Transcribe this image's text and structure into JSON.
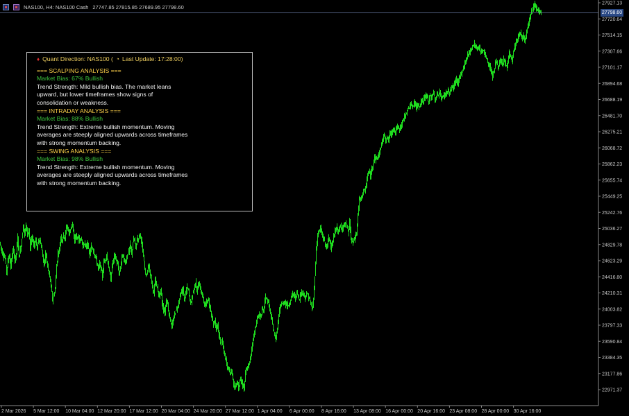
{
  "header": {
    "symbol_info": "NAS100, H4: NAS100 Cash",
    "ohlc": "27747.85 27815.85 27689.95 27798.60"
  },
  "panel": {
    "title": "Quant Direction: NAS100 (",
    "last_update": "Last Update: 17:28:00)",
    "sections": [
      {
        "heading": "=== SCALPING ANALYSIS ===",
        "bias": "Market Bias: 67% Bullish",
        "strength": [
          "Trend Strength: Mild bullish bias. The market leans",
          "upward, but lower timeframes show signs of",
          "consolidation or weakness."
        ]
      },
      {
        "heading": "=== INTRADAY ANALYSIS ===",
        "bias": "Market Bias: 88% Bullish",
        "strength": [
          "Trend Strength: Extreme bullish momentum. Moving",
          "averages are steeply aligned upwards across timeframes",
          "with strong momentum backing."
        ]
      },
      {
        "heading": "=== SWING ANALYSIS ===",
        "bias": "Market Bias: 98% Bullish",
        "strength": [
          "Trend Strength: Extreme bullish momentum. Moving",
          "averages are steeply aligned upwards across timeframes",
          "with strong momentum backing."
        ]
      }
    ]
  },
  "price_tag": "27798.60",
  "chart_data": {
    "type": "candlestick",
    "yticks": [
      "27927.13",
      "27720.64",
      "27514.15",
      "27307.66",
      "27101.17",
      "26894.68",
      "26688.19",
      "26481.70",
      "26275.21",
      "26068.72",
      "25862.23",
      "25655.74",
      "25449.25",
      "25242.76",
      "25036.27",
      "24829.78",
      "24623.29",
      "24416.80",
      "24210.31",
      "24003.82",
      "23797.33",
      "23590.84",
      "23384.35",
      "23177.86",
      "22971.37"
    ],
    "xticks": [
      "2 Mar 2026",
      "5 Mar 12:00",
      "10 Mar 04:00",
      "12 Mar 20:00",
      "17 Mar 12:00",
      "20 Mar 04:00",
      "24 Mar 20:00",
      "27 Mar 12:00",
      "1 Apr 04:00",
      "6 Apr 00:00",
      "8 Apr 16:00",
      "13 Apr 08:00",
      "16 Apr 00:00",
      "20 Apr 16:00",
      "23 Apr 08:00",
      "28 Apr 00:00",
      "30 Apr 16:00"
    ],
    "current_price": 27798.6,
    "up_color": "#1fdc1f",
    "down_color": "#1fdc1f",
    "path": [
      [
        0,
        24860
      ],
      [
        4,
        24720
      ],
      [
        8,
        24650
      ],
      [
        10,
        24480
      ],
      [
        12,
        24620
      ],
      [
        14,
        24700
      ],
      [
        16,
        24540
      ],
      [
        18,
        24700
      ],
      [
        20,
        24760
      ],
      [
        22,
        24620
      ],
      [
        24,
        24720
      ],
      [
        26,
        24920
      ],
      [
        28,
        24680
      ],
      [
        30,
        24760
      ],
      [
        32,
        24900
      ],
      [
        34,
        25090
      ],
      [
        36,
        24950
      ],
      [
        38,
        25090
      ],
      [
        40,
        24970
      ],
      [
        42,
        25000
      ],
      [
        44,
        24780
      ],
      [
        46,
        24920
      ],
      [
        48,
        24890
      ],
      [
        50,
        24800
      ],
      [
        52,
        24920
      ],
      [
        54,
        24760
      ],
      [
        56,
        24900
      ],
      [
        58,
        24880
      ],
      [
        60,
        24800
      ],
      [
        62,
        24690
      ],
      [
        64,
        24560
      ],
      [
        66,
        24720
      ],
      [
        68,
        24620
      ],
      [
        70,
        24500
      ],
      [
        72,
        24420
      ],
      [
        74,
        24300
      ],
      [
        76,
        24120
      ],
      [
        78,
        24180
      ],
      [
        80,
        24260
      ],
      [
        82,
        24560
      ],
      [
        84,
        24720
      ],
      [
        86,
        24760
      ],
      [
        88,
        24930
      ],
      [
        90,
        24880
      ],
      [
        92,
        24960
      ],
      [
        94,
        24900
      ],
      [
        96,
        25060
      ],
      [
        98,
        25050
      ],
      [
        100,
        24960
      ],
      [
        102,
        25040
      ],
      [
        104,
        25090
      ],
      [
        106,
        24990
      ],
      [
        108,
        24880
      ],
      [
        110,
        24960
      ],
      [
        112,
        24880
      ],
      [
        114,
        24930
      ],
      [
        116,
        24880
      ],
      [
        118,
        24900
      ],
      [
        120,
        24800
      ],
      [
        122,
        24860
      ],
      [
        124,
        24780
      ],
      [
        126,
        24860
      ],
      [
        128,
        24760
      ],
      [
        130,
        24700
      ],
      [
        132,
        24800
      ],
      [
        134,
        24780
      ],
      [
        136,
        24720
      ],
      [
        138,
        24680
      ],
      [
        140,
        24600
      ],
      [
        142,
        24520
      ],
      [
        144,
        24580
      ],
      [
        146,
        24520
      ],
      [
        148,
        24420
      ],
      [
        150,
        24600
      ],
      [
        152,
        24640
      ],
      [
        154,
        24700
      ],
      [
        156,
        24600
      ],
      [
        158,
        24480
      ],
      [
        160,
        24380
      ],
      [
        162,
        24560
      ],
      [
        164,
        24640
      ],
      [
        166,
        24700
      ],
      [
        168,
        24620
      ],
      [
        170,
        24570
      ],
      [
        172,
        24460
      ],
      [
        174,
        24520
      ],
      [
        176,
        24690
      ],
      [
        178,
        24680
      ],
      [
        180,
        24600
      ],
      [
        182,
        24620
      ],
      [
        184,
        24700
      ],
      [
        186,
        24740
      ],
      [
        188,
        24820
      ],
      [
        190,
        24700
      ],
      [
        192,
        24860
      ],
      [
        194,
        24900
      ],
      [
        196,
        24780
      ],
      [
        198,
        24900
      ],
      [
        200,
        24920
      ],
      [
        202,
        24960
      ],
      [
        204,
        24900
      ],
      [
        206,
        24740
      ],
      [
        208,
        24600
      ],
      [
        210,
        24460
      ],
      [
        212,
        24440
      ],
      [
        214,
        24560
      ],
      [
        216,
        24500
      ],
      [
        218,
        24420
      ],
      [
        220,
        24260
      ],
      [
        222,
        24200
      ],
      [
        224,
        24400
      ],
      [
        226,
        24300
      ],
      [
        228,
        24240
      ],
      [
        230,
        24160
      ],
      [
        232,
        24260
      ],
      [
        234,
        24080
      ],
      [
        236,
        24000
      ],
      [
        238,
        23960
      ],
      [
        240,
        24120
      ],
      [
        242,
        24060
      ],
      [
        244,
        23940
      ],
      [
        246,
        23860
      ],
      [
        248,
        23760
      ],
      [
        250,
        23860
      ],
      [
        252,
        23940
      ],
      [
        254,
        24000
      ],
      [
        256,
        24020
      ],
      [
        258,
        24100
      ],
      [
        260,
        24180
      ],
      [
        262,
        24220
      ],
      [
        264,
        24260
      ],
      [
        266,
        24120
      ],
      [
        268,
        24200
      ],
      [
        270,
        24280
      ],
      [
        272,
        24240
      ],
      [
        274,
        24120
      ],
      [
        276,
        24080
      ],
      [
        278,
        24200
      ],
      [
        280,
        24260
      ],
      [
        282,
        24360
      ],
      [
        284,
        24240
      ],
      [
        286,
        24300
      ],
      [
        288,
        24320
      ],
      [
        290,
        24220
      ],
      [
        292,
        24180
      ],
      [
        294,
        24100
      ],
      [
        296,
        24040
      ],
      [
        298,
        24100
      ],
      [
        300,
        24140
      ],
      [
        302,
        24040
      ],
      [
        304,
        23980
      ],
      [
        306,
        23900
      ],
      [
        308,
        23800
      ],
      [
        310,
        23860
      ],
      [
        312,
        23760
      ],
      [
        314,
        23820
      ],
      [
        316,
        23660
      ],
      [
        318,
        23560
      ],
      [
        320,
        23620
      ],
      [
        322,
        23500
      ],
      [
        324,
        23420
      ],
      [
        326,
        23340
      ],
      [
        328,
        23220
      ],
      [
        330,
        23260
      ],
      [
        332,
        23180
      ],
      [
        334,
        23240
      ],
      [
        336,
        23100
      ],
      [
        338,
        23000
      ],
      [
        340,
        23020
      ],
      [
        342,
        23080
      ],
      [
        344,
        22980
      ],
      [
        346,
        23120
      ],
      [
        348,
        23060
      ],
      [
        350,
        23040
      ],
      [
        352,
        22980
      ],
      [
        354,
        23180
      ],
      [
        356,
        23240
      ],
      [
        358,
        23260
      ],
      [
        360,
        23320
      ],
      [
        362,
        23440
      ],
      [
        364,
        23560
      ],
      [
        366,
        23660
      ],
      [
        368,
        23760
      ],
      [
        370,
        23840
      ],
      [
        372,
        23900
      ],
      [
        374,
        23940
      ],
      [
        376,
        23900
      ],
      [
        378,
        24000
      ],
      [
        380,
        23980
      ],
      [
        382,
        24120
      ],
      [
        384,
        24160
      ],
      [
        386,
        24100
      ],
      [
        388,
        24060
      ],
      [
        390,
        23940
      ],
      [
        392,
        23860
      ],
      [
        394,
        23740
      ],
      [
        396,
        23680
      ],
      [
        398,
        23620
      ],
      [
        400,
        23760
      ],
      [
        402,
        23920
      ],
      [
        404,
        24020
      ],
      [
        406,
        24080
      ],
      [
        408,
        24060
      ],
      [
        410,
        24100
      ],
      [
        412,
        24080
      ],
      [
        414,
        24040
      ],
      [
        416,
        24060
      ],
      [
        418,
        24080
      ],
      [
        420,
        24160
      ],
      [
        422,
        24200
      ],
      [
        424,
        24180
      ],
      [
        426,
        24140
      ],
      [
        428,
        24220
      ],
      [
        430,
        24160
      ],
      [
        432,
        24120
      ],
      [
        434,
        24240
      ],
      [
        436,
        24180
      ],
      [
        438,
        24220
      ],
      [
        440,
        24140
      ],
      [
        442,
        24200
      ],
      [
        444,
        24180
      ],
      [
        446,
        24140
      ],
      [
        448,
        24060
      ],
      [
        450,
        24000
      ],
      [
        452,
        24120
      ],
      [
        454,
        24440
      ],
      [
        456,
        24760
      ],
      [
        458,
        24960
      ],
      [
        460,
        25000
      ],
      [
        462,
        25040
      ],
      [
        464,
        24960
      ],
      [
        466,
        24920
      ],
      [
        468,
        24860
      ],
      [
        470,
        24800
      ],
      [
        472,
        24820
      ],
      [
        474,
        24920
      ],
      [
        476,
        24860
      ],
      [
        478,
        24800
      ],
      [
        480,
        24860
      ],
      [
        482,
        24960
      ],
      [
        484,
        25020
      ],
      [
        486,
        25040
      ],
      [
        488,
        25000
      ],
      [
        490,
        25040
      ],
      [
        492,
        25060
      ],
      [
        494,
        25040
      ],
      [
        496,
        25080
      ],
      [
        498,
        25100
      ],
      [
        500,
        25060
      ],
      [
        502,
        24980
      ],
      [
        504,
        25120
      ],
      [
        506,
        24900
      ],
      [
        508,
        24860
      ],
      [
        510,
        24880
      ],
      [
        512,
        24920
      ],
      [
        514,
        24980
      ],
      [
        516,
        25200
      ],
      [
        518,
        25420
      ],
      [
        520,
        25400
      ],
      [
        522,
        25460
      ],
      [
        524,
        25540
      ],
      [
        526,
        25500
      ],
      [
        528,
        25600
      ],
      [
        530,
        25720
      ],
      [
        532,
        25760
      ],
      [
        534,
        25700
      ],
      [
        536,
        25800
      ],
      [
        538,
        25880
      ],
      [
        540,
        25960
      ],
      [
        542,
        25920
      ],
      [
        544,
        25940
      ],
      [
        546,
        25980
      ],
      [
        548,
        26040
      ],
      [
        550,
        26120
      ],
      [
        552,
        26180
      ],
      [
        554,
        26240
      ],
      [
        556,
        26180
      ],
      [
        558,
        26200
      ],
      [
        560,
        26160
      ],
      [
        562,
        26260
      ],
      [
        564,
        26240
      ],
      [
        566,
        26300
      ],
      [
        568,
        26320
      ],
      [
        570,
        26260
      ],
      [
        572,
        26340
      ],
      [
        574,
        26320
      ],
      [
        576,
        26300
      ],
      [
        578,
        26360
      ],
      [
        580,
        26400
      ],
      [
        582,
        26440
      ],
      [
        584,
        26480
      ],
      [
        586,
        26520
      ],
      [
        588,
        26560
      ],
      [
        590,
        26600
      ],
      [
        592,
        26620
      ],
      [
        594,
        26580
      ],
      [
        596,
        26620
      ],
      [
        598,
        26660
      ],
      [
        600,
        26560
      ],
      [
        602,
        26640
      ],
      [
        604,
        26600
      ],
      [
        606,
        26620
      ],
      [
        608,
        26680
      ],
      [
        610,
        26660
      ],
      [
        612,
        26720
      ],
      [
        614,
        26740
      ],
      [
        616,
        26700
      ],
      [
        618,
        26660
      ],
      [
        620,
        26740
      ],
      [
        622,
        26700
      ],
      [
        624,
        26780
      ],
      [
        626,
        26720
      ],
      [
        628,
        26680
      ],
      [
        630,
        26760
      ],
      [
        632,
        26740
      ],
      [
        634,
        26780
      ],
      [
        636,
        26700
      ],
      [
        638,
        26720
      ],
      [
        640,
        26740
      ],
      [
        642,
        26760
      ],
      [
        644,
        26780
      ],
      [
        646,
        26800
      ],
      [
        648,
        26760
      ],
      [
        650,
        26820
      ],
      [
        652,
        26860
      ],
      [
        654,
        26840
      ],
      [
        656,
        26920
      ],
      [
        658,
        26940
      ],
      [
        660,
        26880
      ],
      [
        662,
        26960
      ],
      [
        664,
        27020
      ],
      [
        666,
        27040
      ],
      [
        668,
        27080
      ],
      [
        670,
        27160
      ],
      [
        672,
        27200
      ],
      [
        674,
        27260
      ],
      [
        676,
        27280
      ],
      [
        678,
        27320
      ],
      [
        680,
        27360
      ],
      [
        682,
        27380
      ],
      [
        684,
        27400
      ],
      [
        686,
        27360
      ],
      [
        688,
        27340
      ],
      [
        690,
        27360
      ],
      [
        692,
        27320
      ],
      [
        694,
        27300
      ],
      [
        696,
        27320
      ],
      [
        698,
        27280
      ],
      [
        700,
        27240
      ],
      [
        702,
        27200
      ],
      [
        704,
        27140
      ],
      [
        706,
        27100
      ],
      [
        708,
        27060
      ],
      [
        710,
        26980
      ],
      [
        712,
        27060
      ],
      [
        714,
        27140
      ],
      [
        716,
        27180
      ],
      [
        718,
        27100
      ],
      [
        720,
        27140
      ],
      [
        722,
        27180
      ],
      [
        724,
        27120
      ],
      [
        726,
        27200
      ],
      [
        728,
        27160
      ],
      [
        730,
        27100
      ],
      [
        732,
        27160
      ],
      [
        734,
        27300
      ],
      [
        736,
        27220
      ],
      [
        738,
        27180
      ],
      [
        740,
        27300
      ],
      [
        742,
        27360
      ],
      [
        744,
        27420
      ],
      [
        746,
        27460
      ],
      [
        748,
        27520
      ],
      [
        750,
        27540
      ],
      [
        752,
        27480
      ],
      [
        754,
        27500
      ],
      [
        756,
        27440
      ],
      [
        758,
        27520
      ],
      [
        760,
        27600
      ],
      [
        762,
        27680
      ],
      [
        764,
        27760
      ],
      [
        766,
        27820
      ],
      [
        768,
        27860
      ],
      [
        770,
        27900
      ],
      [
        772,
        27880
      ],
      [
        774,
        27860
      ],
      [
        776,
        27820
      ],
      [
        778,
        27800
      ],
      [
        780,
        27798
      ]
    ]
  }
}
